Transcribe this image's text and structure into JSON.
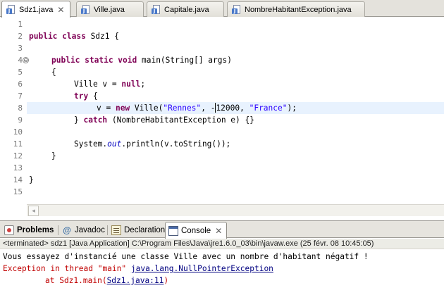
{
  "editor_tabs": [
    {
      "label": "Sdz1.java",
      "active": true,
      "close": "✕"
    },
    {
      "label": "Ville.java"
    },
    {
      "label": "Capitale.java"
    },
    {
      "label": "NombreHabitantException.java"
    }
  ],
  "code": {
    "line_numbers": [
      "1",
      "2",
      "3",
      "4",
      "5",
      "6",
      "7",
      "8",
      "9",
      "10",
      "11",
      "12",
      "13",
      "14",
      "15"
    ],
    "fold_marker": "⊖",
    "l2": {
      "kw": "public class",
      "rest": " Sdz1 {"
    },
    "l4": {
      "kw": "public static void",
      "rest": " main(String[] args)"
    },
    "l5": "{",
    "l6": {
      "pre": "Ville v = ",
      "kw": "null",
      "post": ";"
    },
    "l7": {
      "kw": "try",
      "post": " {"
    },
    "l8": {
      "pre": "v = ",
      "kw": "new",
      "mid": " Ville(",
      "s1": "\"Rennes\"",
      "c1": ", -",
      "num": "12000, ",
      "s2": "\"France\"",
      "post": ");"
    },
    "l9": {
      "pre": "} ",
      "kw": "catch",
      "post": " (NombreHabitantException e) {}"
    },
    "l11": {
      "pre": "System.",
      "it": "out",
      "post": ".println(v.toString());"
    },
    "l12": "}",
    "l14": "}"
  },
  "views": {
    "tabs": [
      {
        "label": "Problems",
        "icon": "problems-icon"
      },
      {
        "label": "Javadoc",
        "icon": "javadoc-icon",
        "glyph": "@"
      },
      {
        "label": "Declaration",
        "icon": "declaration-icon"
      },
      {
        "label": "Console",
        "icon": "console-icon",
        "active": true,
        "close": "✕"
      }
    ],
    "status": "<terminated> sdz1 [Java Application] C:\\Program Files\\Java\\jre1.6.0_03\\bin\\javaw.exe (25 févr. 08 10:45:05)",
    "console": {
      "line1": "Vous essayez d'instancié une classe Ville avec un nombre d'habitant négatif !",
      "line2_pre": "Exception in thread \"main\" ",
      "line2_link": "java.lang.NullPointerException",
      "line3_pre": "\tat Sdz1.main(",
      "line3_link": "Sdz1.java:11",
      "line3_post": ")"
    }
  },
  "scroll": {
    "left_arrow": "◂"
  }
}
